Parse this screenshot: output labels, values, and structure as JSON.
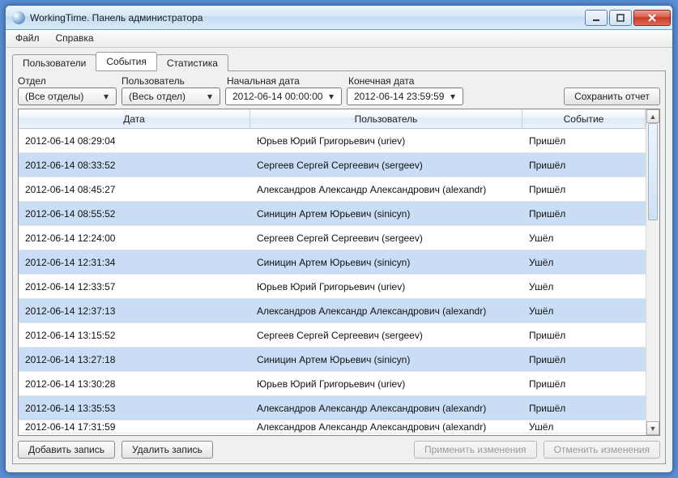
{
  "window": {
    "title": "WorkingTime. Панель администратора"
  },
  "menu": {
    "file": "Файл",
    "help": "Справка"
  },
  "tabs": {
    "users": "Пользователи",
    "events": "События",
    "stats": "Статистика"
  },
  "filters": {
    "dept_label": "Отдел",
    "user_label": "Пользователь",
    "start_label": "Начальная дата",
    "end_label": "Конечная дата",
    "dept_value": "(Все отделы)",
    "user_value": "(Весь отдел)",
    "start_value": "2012-06-14 00:00:00",
    "end_value": "2012-06-14 23:59:59",
    "save_report": "Сохранить отчет"
  },
  "grid": {
    "col_date": "Дата",
    "col_user": "Пользователь",
    "col_event": "Событие",
    "rows": [
      {
        "date": "2012-06-14 08:29:04",
        "user": "Юрьев Юрий Григорьевич (uriev)",
        "event": "Пришёл"
      },
      {
        "date": "2012-06-14 08:33:52",
        "user": "Сергеев Сергей Сергеевич (sergeev)",
        "event": "Пришёл"
      },
      {
        "date": "2012-06-14 08:45:27",
        "user": "Александров Александр Александрович (alexandr)",
        "event": "Пришёл"
      },
      {
        "date": "2012-06-14 08:55:52",
        "user": "Синицин Артем Юрьевич (sinicyn)",
        "event": "Пришёл"
      },
      {
        "date": "2012-06-14 12:24:00",
        "user": "Сергеев Сергей Сергеевич (sergeev)",
        "event": "Ушёл"
      },
      {
        "date": "2012-06-14 12:31:34",
        "user": "Синицин Артем Юрьевич (sinicyn)",
        "event": "Ушёл"
      },
      {
        "date": "2012-06-14 12:33:57",
        "user": "Юрьев Юрий Григорьевич (uriev)",
        "event": "Ушёл"
      },
      {
        "date": "2012-06-14 12:37:13",
        "user": "Александров Александр Александрович (alexandr)",
        "event": "Ушёл"
      },
      {
        "date": "2012-06-14 13:15:52",
        "user": "Сергеев Сергей Сергеевич (sergeev)",
        "event": "Пришёл"
      },
      {
        "date": "2012-06-14 13:27:18",
        "user": "Синицин Артем Юрьевич (sinicyn)",
        "event": "Пришёл"
      },
      {
        "date": "2012-06-14 13:30:28",
        "user": "Юрьев Юрий Григорьевич (uriev)",
        "event": "Пришёл"
      },
      {
        "date": "2012-06-14 13:35:53",
        "user": "Александров Александр Александрович (alexandr)",
        "event": "Пришёл"
      },
      {
        "date": "2012-06-14 17:31:59",
        "user": "Александров Александр Александрович (alexandr)",
        "event": "Ушёл"
      }
    ]
  },
  "actions": {
    "add": "Добавить запись",
    "delete": "Удалить запись",
    "apply": "Применить изменения",
    "cancel": "Отменить изменения"
  }
}
